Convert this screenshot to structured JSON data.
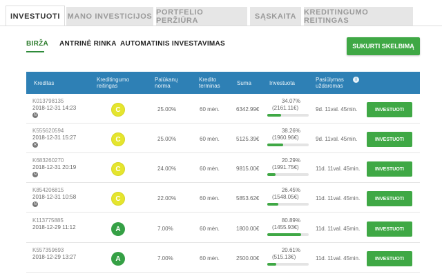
{
  "top_tabs": [
    {
      "label": "INVESTUOTI"
    },
    {
      "label": "MANO INVESTICIJOS"
    },
    {
      "label": "PORTFELIO PERŽIŪRA"
    },
    {
      "label": "SĄSKAITA"
    },
    {
      "label": "Kreditingumo reitingas"
    }
  ],
  "sub_tabs": [
    {
      "label": "BIRŽA"
    },
    {
      "label": "ANTRINĖ RINKA"
    },
    {
      "label": "AUTOMATINIS INVESTAVIMAS"
    }
  ],
  "create_button": "SUKURTI SKELBIMĄ",
  "table": {
    "headers": [
      "Kreditas",
      "Kreditingumo reitingas",
      "Palūkanų norma",
      "Kredito terminas",
      "Suma",
      "Investuota",
      "Pasiūlymas uždaromas"
    ],
    "info_icon": "i",
    "rows": [
      {
        "code": "K013798135",
        "date": "2018-12-31 14:23",
        "badge": "N",
        "rating": "C",
        "rate": "25.00%",
        "term": "60 mėn.",
        "sum": "6342.99€",
        "pct": "34.07%",
        "invested": "(2161.11€)",
        "progress": 0.3407,
        "remaining": "9d. 11val. 45min.",
        "button": "INVESTUOTI"
      },
      {
        "code": "K555620594",
        "date": "2018-12-31 15:27",
        "badge": "R",
        "rating": "C",
        "rate": "25.00%",
        "term": "60 mėn.",
        "sum": "5125.39€",
        "pct": "38.26%",
        "invested": "(1960.96€)",
        "progress": 0.3826,
        "remaining": "9d. 11val. 45min.",
        "button": "INVESTUOTI"
      },
      {
        "code": "K683260270",
        "date": "2018-12-31 20:19",
        "badge": "N",
        "rating": "C",
        "rate": "24.00%",
        "term": "60 mėn.",
        "sum": "9815.00€",
        "pct": "20.29%",
        "invested": "(1991.75€)",
        "progress": 0.2029,
        "remaining": "11d. 11val. 45min.",
        "button": "INVESTUOTI"
      },
      {
        "code": "K854206815",
        "date": "2018-12-31 10:58",
        "badge": "N",
        "rating": "C",
        "rate": "22.00%",
        "term": "60 mėn.",
        "sum": "5853.62€",
        "pct": "26.45%",
        "invested": "(1548.05€)",
        "progress": 0.2645,
        "remaining": "11d. 11val. 45min.",
        "button": "INVESTUOTI"
      },
      {
        "code": "K113775885",
        "date": "2018-12-29 11:12",
        "badge": "",
        "rating": "A",
        "rate": "7.00%",
        "term": "60 mėn.",
        "sum": "1800.00€",
        "pct": "80.89%",
        "invested": "(1455.93€)",
        "progress": 0.8089,
        "remaining": "11d. 11val. 45min.",
        "button": "INVESTUOTI"
      },
      {
        "code": "K557359693",
        "date": "2018-12-29 13:27",
        "badge": "",
        "rating": "A",
        "rate": "7.00%",
        "term": "60 mėn.",
        "sum": "2500.00€",
        "pct": "20.61%",
        "invested": "(515.13€)",
        "progress": 0.2061,
        "remaining": "11d. 11val. 45min.",
        "button": "INVESTUOTI"
      }
    ]
  },
  "colors": {
    "accent_green": "#3fa845",
    "header_blue": "#2e80b5",
    "rating_c": "#e5e52e",
    "rating_a": "#35a045"
  }
}
